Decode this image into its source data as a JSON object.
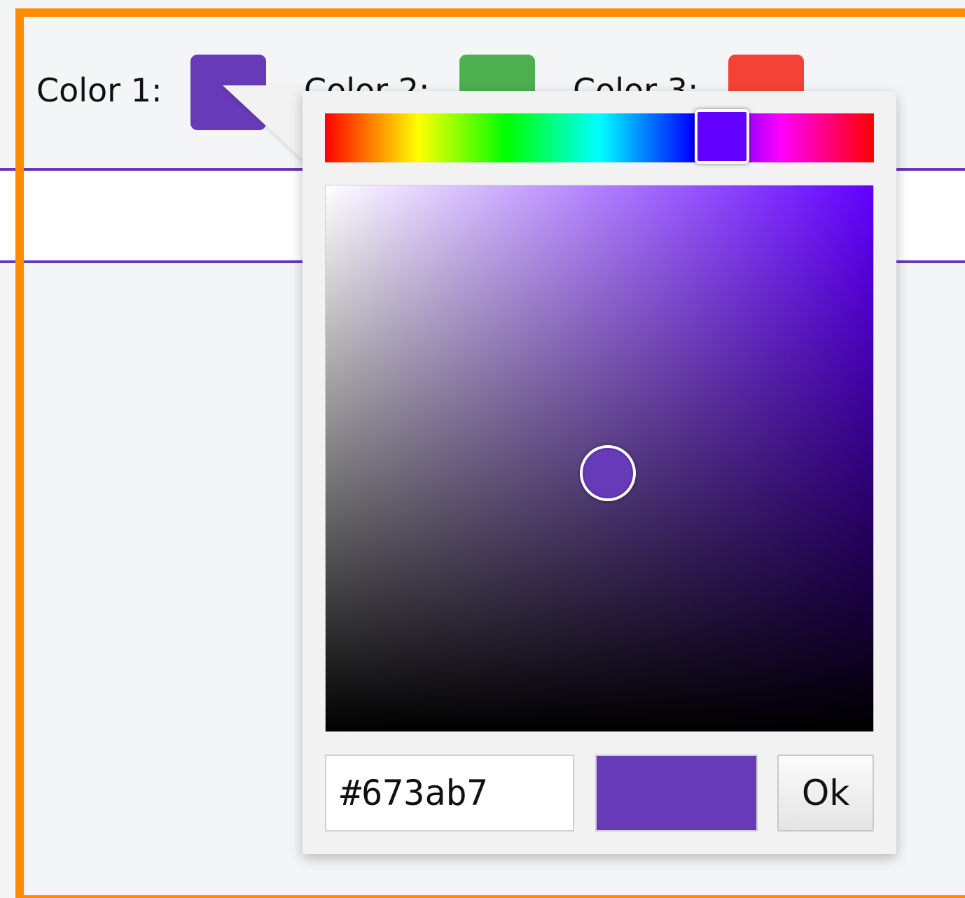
{
  "colors": {
    "frame": "#ff8c00",
    "background": "#f3f5f7",
    "strip_border": "#673ab7"
  },
  "pickers": [
    {
      "label": "Color 1:",
      "value": "#673ab7"
    },
    {
      "label": "Color 2:",
      "value": "#4caf50"
    },
    {
      "label": "Color 3:",
      "value": "#f44336"
    }
  ],
  "popup": {
    "hue_color": "#6200ff",
    "hex_value": "#673ab7",
    "preview_color": "#673ab7",
    "ok_label": "Ok"
  }
}
